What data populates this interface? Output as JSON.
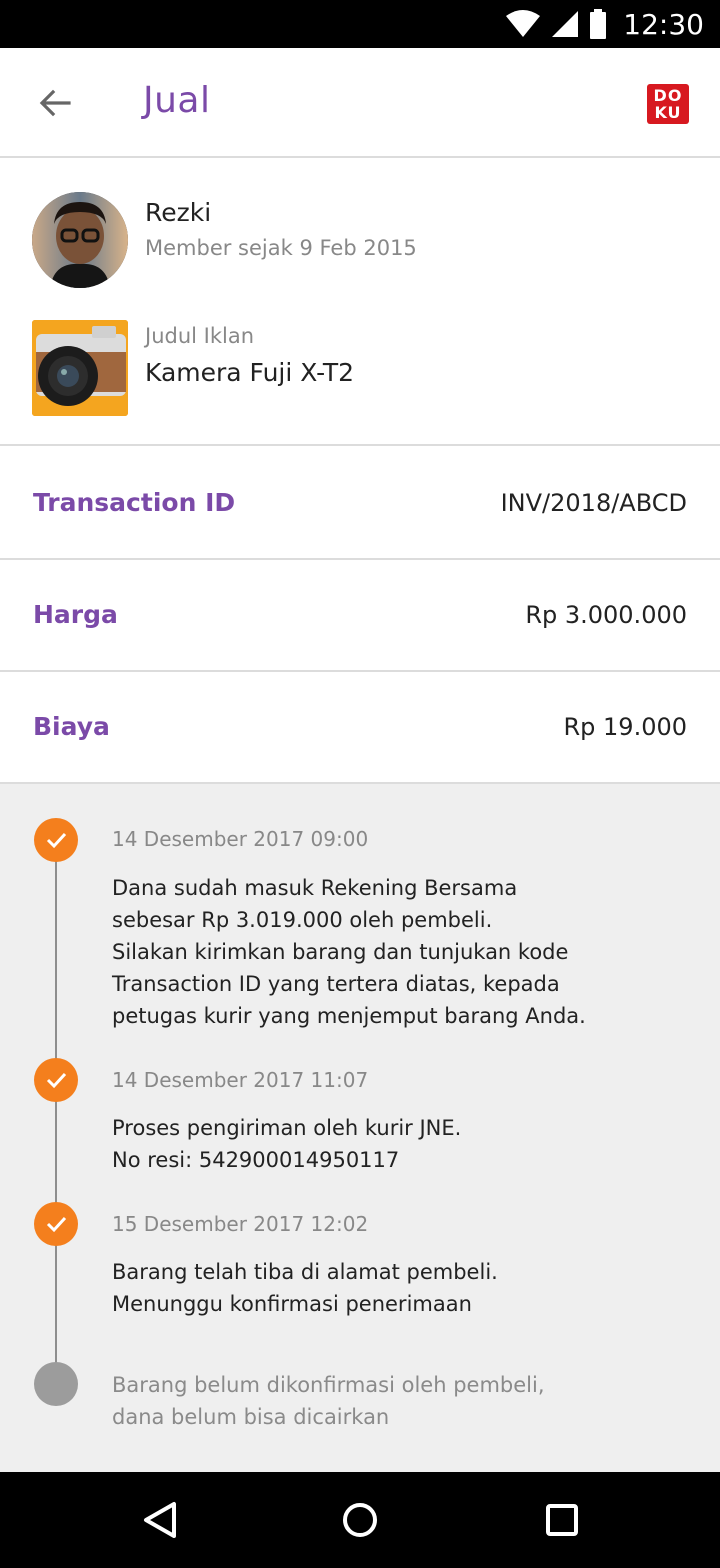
{
  "status_bar": {
    "time": "12:30",
    "icons": [
      "wifi-icon",
      "signal-icon",
      "battery-icon"
    ]
  },
  "app_bar": {
    "title": "Jual",
    "back_icon": "arrow-back-icon",
    "logo_text_top": "DO",
    "logo_text_bottom": "KU"
  },
  "seller": {
    "name": "Rezki",
    "member_since": "Member sejak 9 Feb 2015"
  },
  "listing": {
    "label": "Judul Iklan",
    "title": "Kamera Fuji X-T2"
  },
  "details": {
    "transaction_id_label": "Transaction ID",
    "transaction_id_value": "INV/2018/ABCD",
    "price_label": "Harga",
    "price_value": "Rp 3.000.000",
    "fee_label": "Biaya",
    "fee_value": "Rp 19.000"
  },
  "timeline": [
    {
      "date": "14 Desember 2017 09:00",
      "text": "Dana sudah masuk Rekening Bersama\nsebesar Rp 3.019.000 oleh pembeli.\nSilakan kirimkan barang dan tunjukan kode\nTransaction ID yang tertera diatas, kepada\npetugas kurir yang menjemput barang Anda.",
      "status": "done"
    },
    {
      "date": "14 Desember 2017 11:07",
      "text": "Proses pengiriman oleh kurir JNE.\nNo resi: 542900014950117",
      "status": "done"
    },
    {
      "date": "15 Desember 2017 12:02",
      "text": "Barang telah tiba di alamat pembeli.\nMenunggu konfirmasi penerimaan",
      "status": "done"
    },
    {
      "text": "Barang belum dikonfirmasi oleh pembeli,\ndana belum bisa dicairkan",
      "status": "pending"
    }
  ],
  "colors": {
    "accent": "#7b4aa8",
    "timeline_done": "#f47f1d",
    "timeline_pending": "#9c9c9c",
    "brand_doku": "#d71920"
  },
  "nav_bar": {
    "icons": [
      "back-triangle-icon",
      "home-circle-icon",
      "recents-square-icon"
    ]
  }
}
